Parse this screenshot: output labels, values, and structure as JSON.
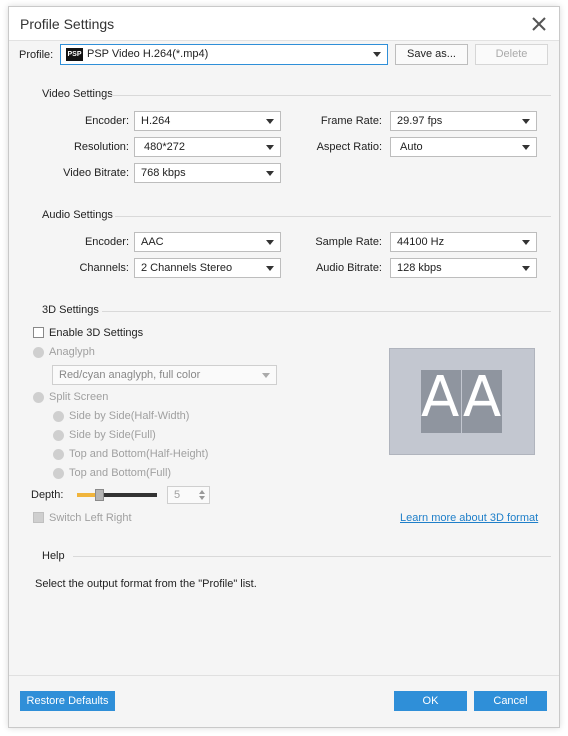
{
  "window": {
    "title": "Profile Settings"
  },
  "profile": {
    "label": "Profile:",
    "value": "PSP Video H.264(*.mp4)",
    "icon_text": "PSP",
    "save_as": "Save as...",
    "delete": "Delete"
  },
  "video": {
    "title": "Video Settings",
    "encoder_label": "Encoder:",
    "encoder": "H.264",
    "resolution_label": "Resolution:",
    "resolution": "480*272",
    "bitrate_label": "Video Bitrate:",
    "bitrate": "768 kbps",
    "framerate_label": "Frame Rate:",
    "framerate": "29.97 fps",
    "aspect_label": "Aspect Ratio:",
    "aspect": "Auto"
  },
  "audio": {
    "title": "Audio Settings",
    "encoder_label": "Encoder:",
    "encoder": "AAC",
    "channels_label": "Channels:",
    "channels": "2 Channels Stereo",
    "samplerate_label": "Sample Rate:",
    "samplerate": "44100 Hz",
    "bitrate_label": "Audio Bitrate:",
    "bitrate": "128 kbps"
  },
  "three_d": {
    "title": "3D Settings",
    "enable": "Enable 3D Settings",
    "anaglyph": "Anaglyph",
    "anaglyph_mode": "Red/cyan anaglyph, full color",
    "split_screen": "Split Screen",
    "options": [
      "Side by Side(Half-Width)",
      "Side by Side(Full)",
      "Top and Bottom(Half-Height)",
      "Top and Bottom(Full)"
    ],
    "depth_label": "Depth:",
    "depth_value": "5",
    "depth_fraction": 0.25,
    "switch_lr": "Switch Left Right",
    "learn_more": "Learn more about 3D format",
    "preview_text": "AA"
  },
  "help": {
    "title": "Help",
    "text": "Select the output format from the \"Profile\" list."
  },
  "footer": {
    "restore": "Restore Defaults",
    "ok": "OK",
    "cancel": "Cancel"
  },
  "colors": {
    "accent": "#2f8fd8",
    "link": "#1f7fc9",
    "preview_bg": "#c3c7d0",
    "preview_tile": "#8f959f"
  }
}
